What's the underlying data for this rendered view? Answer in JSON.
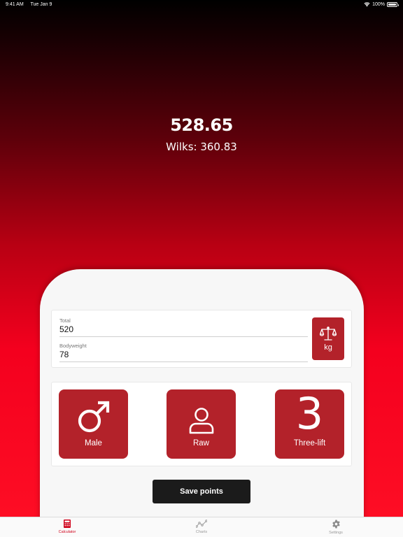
{
  "status_bar": {
    "time": "9:41 AM",
    "date": "Tue Jan 9",
    "battery": "100%"
  },
  "result": {
    "points": "528.65",
    "wilks": "Wilks: 360.83"
  },
  "inputs": {
    "total_label": "Total",
    "total_value": "520",
    "bodyweight_label": "Bodyweight",
    "bodyweight_value": "78"
  },
  "unit_button": {
    "label": "kg",
    "icon": "scale-icon"
  },
  "options": [
    {
      "label": "Male",
      "icon": "male-icon"
    },
    {
      "label": "Raw",
      "icon": "person-icon"
    },
    {
      "label": "Three-lift",
      "glyph": "3",
      "icon": "three-icon"
    }
  ],
  "save_button": {
    "label": "Save points"
  },
  "tabs": [
    {
      "label": "Calculator",
      "icon": "calculator-icon",
      "active": true
    },
    {
      "label": "Charts",
      "icon": "chart-icon",
      "active": false
    },
    {
      "label": "Settings",
      "icon": "gear-icon",
      "active": false
    }
  ],
  "colors": {
    "accent": "#b3222a",
    "tab_active": "#d0021b",
    "save_button": "#1b1b1b",
    "card_background": "#f7f7f7"
  }
}
